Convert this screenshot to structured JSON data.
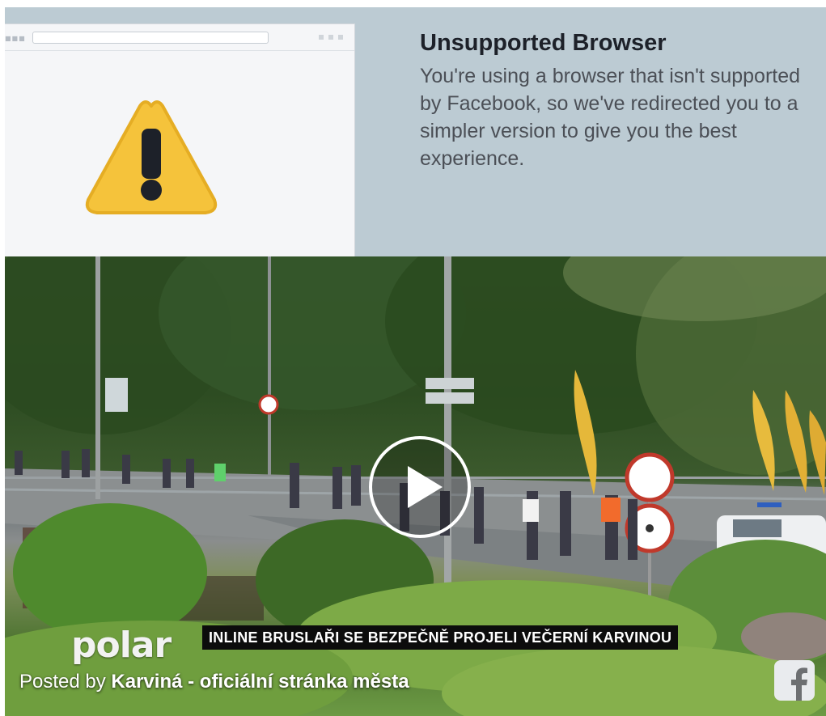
{
  "banner": {
    "title": "Unsupported Browser",
    "message": "You're using a browser that isn't supported by Facebook, so we've redirected you to a simpler version to give you the best experience.",
    "icon": "warning-icon"
  },
  "video": {
    "caption": "INLINE BRUSLAŘI SE BEZPEČNĚ PROJELI VEČERNÍ KARVINOU",
    "channel_logo": "polar",
    "posted_by_prefix": "Posted by",
    "page_name": "Karviná - oficiální stránka města",
    "play_icon": "play-icon",
    "platform_icon": "facebook-icon"
  },
  "colors": {
    "banner_background": "#bccbd3",
    "warning_yellow": "#f5c33b",
    "facebook_logo": "#e9ebee"
  }
}
